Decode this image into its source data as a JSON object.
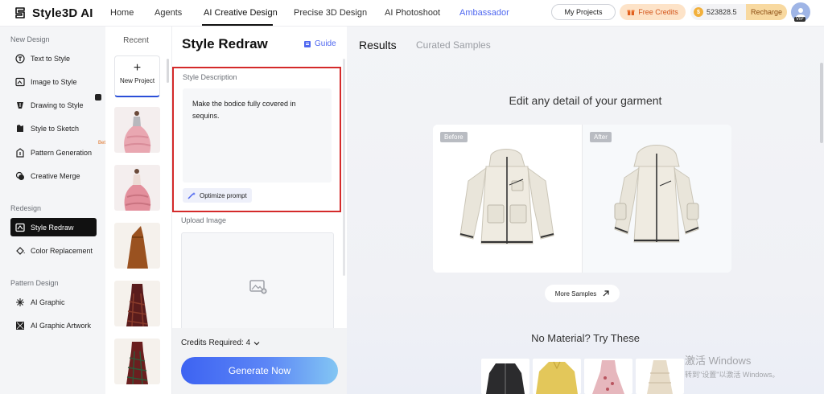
{
  "app": {
    "name": "Style3D AI",
    "nav": [
      "Home",
      "Agents",
      "AI Creative Design",
      "Precise 3D Design",
      "AI Photoshoot",
      "Ambassador"
    ],
    "my_projects": "My Projects",
    "free_credits": "Free Credits",
    "credits_balance": "523828.5",
    "recharge": "Recharge",
    "vip": "VIP"
  },
  "sidebar": {
    "sections": [
      {
        "title": "New Design",
        "items": [
          "Text to Style",
          "Image to Style",
          "Drawing to Style",
          "Style to Sketch",
          "Pattern Generation",
          "Creative Merge"
        ]
      },
      {
        "title": "Redesign",
        "items": [
          "Style Redraw",
          "Color Replacement"
        ]
      },
      {
        "title": "Pattern Design",
        "items": [
          "AI Graphic",
          "AI Graphic Artwork"
        ]
      }
    ],
    "beta_label": "Beta",
    "active_item": "Style Redraw"
  },
  "recent": {
    "title": "Recent",
    "new_project_plus": "+",
    "new_project": "New Project"
  },
  "panel": {
    "title": "Style Redraw",
    "guide": "Guide",
    "style_description_label": "Style Description",
    "style_description_value": "Make the bodice fully covered in sequins.",
    "optimize_prompt": "Optimize prompt",
    "upload_image_label": "Upload Image",
    "credits_required": "Credits Required: 4",
    "generate": "Generate Now"
  },
  "results": {
    "tabs": [
      "Results",
      "Curated Samples"
    ],
    "headline": "Edit any detail of your garment",
    "before": "Before",
    "after": "After",
    "more_samples": "More Samples",
    "no_material": "No Material? Try These"
  },
  "watermark": {
    "line1": "激活 Windows",
    "line2": "转到\"设置\"以激活 Windows。"
  },
  "colors": {
    "accent": "#4e67f0",
    "highlight_border": "#d42a2a",
    "generate_start": "#3d63f2",
    "generate_end": "#83c6f3",
    "active_item_bg": "#111111"
  }
}
